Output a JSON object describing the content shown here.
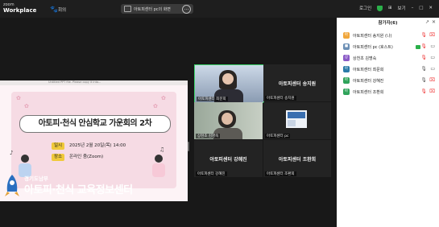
{
  "topbar": {
    "brand_line1": "zoom",
    "brand_line2": "Workplace",
    "meeting_label": "회의",
    "share_text": "아토피센터 pc의 화면",
    "share_more": "…",
    "right_user_label": "로그인",
    "view_label": "보기",
    "minimize": "–",
    "maximize": "□",
    "close": "✕"
  },
  "slide": {
    "titlebar": "Untitled PPT file. Please copy it into...",
    "title": "아토피·천식 안심학교 가운회의 2차",
    "date_key": "일시",
    "date_value": "2025년 2월 20일(목) 14:00",
    "place_key": "장소",
    "place_value": "온라인 줌(Zoom)"
  },
  "tiles": [
    {
      "center_name": "",
      "label": "아토피센터 최문희",
      "has_video": true
    },
    {
      "center_name": "아토피센터 송지원",
      "label": "아토피센터 송지원",
      "has_video": false
    },
    {
      "center_name": "",
      "label": "상천초 김명숙",
      "has_video": true
    },
    {
      "center_name": "",
      "label": "아토피센터 pc",
      "has_video": true
    },
    {
      "center_name": "아토피센터 강혜진",
      "label": "아토피센터 강혜진",
      "has_video": false
    },
    {
      "center_name": "아토피센터 조환희",
      "label": "아토피센터 조환희",
      "has_video": false
    }
  ],
  "logo": {
    "line1": "경기도남부",
    "line2": "아토피·천식 교육정보센터"
  },
  "panel": {
    "title": "참가자(6)",
    "external": "↗",
    "close": "✕",
    "participants": [
      {
        "avatar": "아",
        "avatar_color": "#f0a63b",
        "name": "아토피센터 송지원 (나)",
        "status": "muted"
      },
      {
        "avatar": "■",
        "avatar_color": "#6b8fb5",
        "name": "아토피센터 pc (호스트)",
        "status": "host"
      },
      {
        "avatar": "상",
        "avatar_color": "#8a5ac6",
        "name": "상천초 김명숙",
        "status": "muted"
      },
      {
        "avatar": "아",
        "avatar_color": "#2a7ba8",
        "name": "아토피센터 최문희",
        "status": "mic"
      },
      {
        "avatar": "아",
        "avatar_color": "#2fa35a",
        "name": "아토피센터 강혜진",
        "status": "mic"
      },
      {
        "avatar": "아",
        "avatar_color": "#2fa35a",
        "name": "아토피센터 조환희",
        "status": "muted"
      }
    ]
  }
}
